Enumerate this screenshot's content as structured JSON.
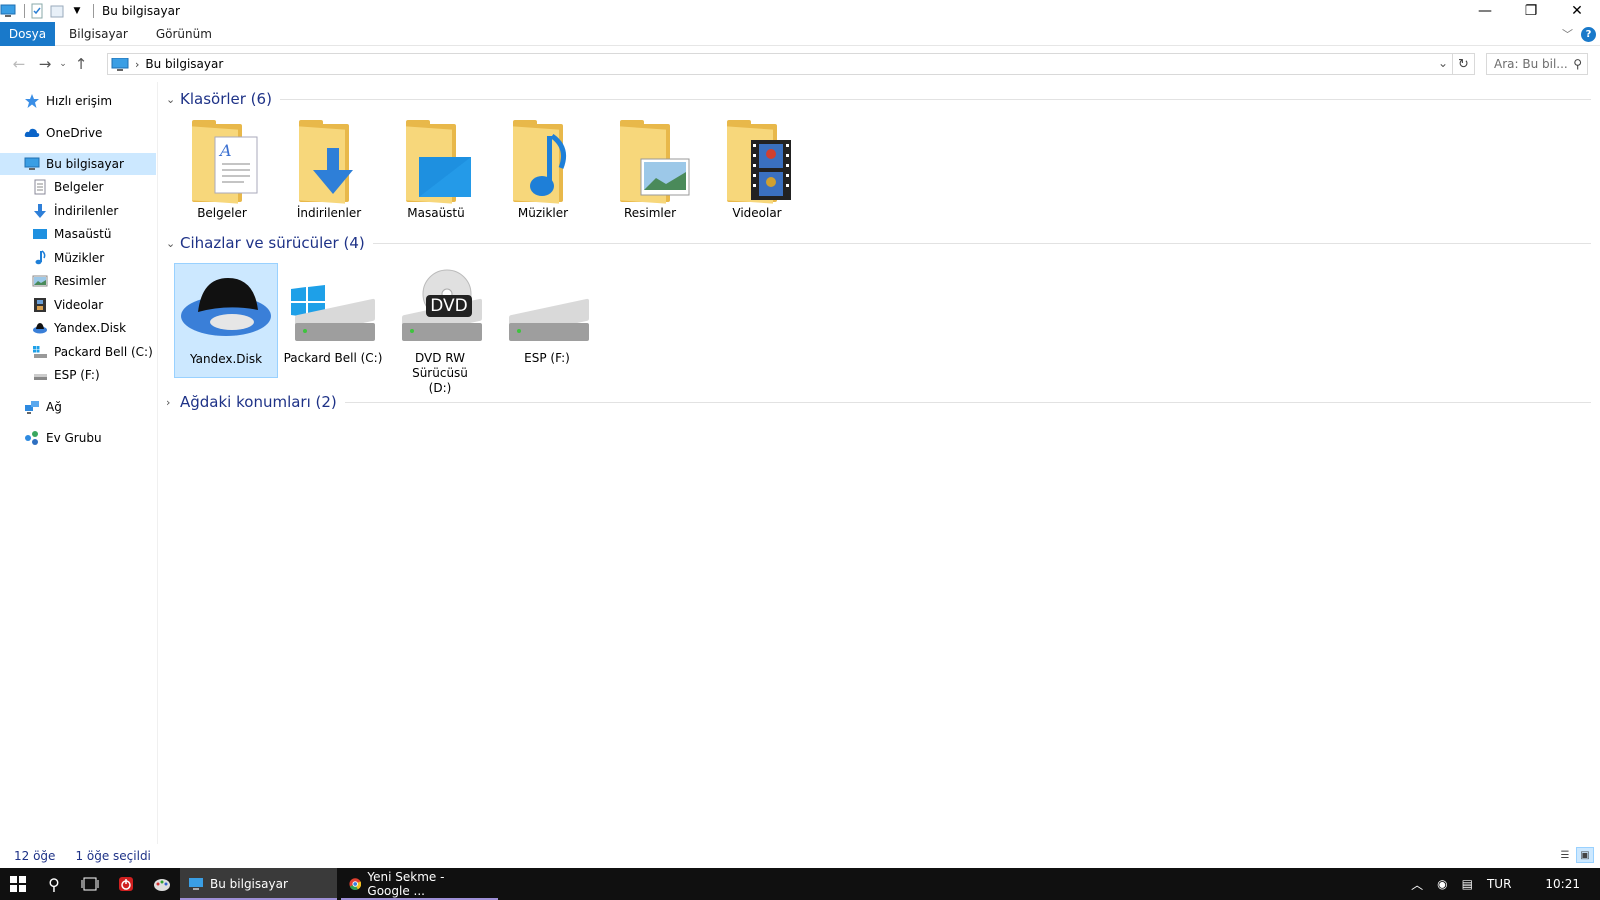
{
  "window": {
    "title": "Bu bilgisayar",
    "controls": {
      "minimize": "—",
      "restore": "❐",
      "close": "✕"
    }
  },
  "ribbon": {
    "tabs": [
      {
        "label": "Dosya",
        "active": true
      },
      {
        "label": "Bilgisayar"
      },
      {
        "label": "Görünüm"
      }
    ],
    "help": "?"
  },
  "address": {
    "path": "Bu bilgisayar",
    "search_placeholder": "Ara: Bu bil..."
  },
  "navpane": {
    "items": [
      {
        "label": "Hızlı erişim",
        "icon": "star-icon"
      },
      {
        "label": "OneDrive",
        "icon": "cloud-icon"
      },
      {
        "label": "Bu bilgisayar",
        "icon": "computer-icon",
        "selected": true
      },
      {
        "label": "Belgeler",
        "icon": "document-icon"
      },
      {
        "label": "İndirilenler",
        "icon": "download-icon"
      },
      {
        "label": "Masaüstü",
        "icon": "desktop-icon"
      },
      {
        "label": "Müzikler",
        "icon": "music-icon"
      },
      {
        "label": "Resimler",
        "icon": "picture-icon"
      },
      {
        "label": "Videolar",
        "icon": "video-icon"
      },
      {
        "label": "Yandex.Disk",
        "icon": "yandex-disk-icon"
      },
      {
        "label": "Packard Bell (C:)",
        "icon": "drive-icon"
      },
      {
        "label": "ESP (F:)",
        "icon": "drive-icon"
      },
      {
        "label": "Ağ",
        "icon": "network-icon"
      },
      {
        "label": "Ev Grubu",
        "icon": "homegroup-icon"
      }
    ]
  },
  "groups": {
    "folders": {
      "title": "Klasörler (6)",
      "items": [
        "Belgeler",
        "İndirilenler",
        "Masaüstü",
        "Müzikler",
        "Resimler",
        "Videolar"
      ]
    },
    "devices": {
      "title": "Cihazlar ve sürücüler (4)",
      "items": [
        "Yandex.Disk",
        "Packard Bell (C:)",
        "DVD RW Sürücüsü (D:)",
        "ESP (F:)"
      ],
      "dvd_badge": "DVD"
    },
    "network": {
      "title": "Ağdaki konumları (2)"
    }
  },
  "status": {
    "count": "12 öğe",
    "selected": "1 öğe seçildi"
  },
  "taskbar": {
    "apps": [
      {
        "label": "Bu bilgisayar",
        "active": true
      },
      {
        "label": "Yeni Sekme - Google ..."
      }
    ],
    "language": "TUR",
    "time": "10:21"
  },
  "colors": {
    "accent": "#1979ca",
    "selection": "#cce8ff",
    "group_title": "#1e3287",
    "folder": "#f7d77b"
  }
}
